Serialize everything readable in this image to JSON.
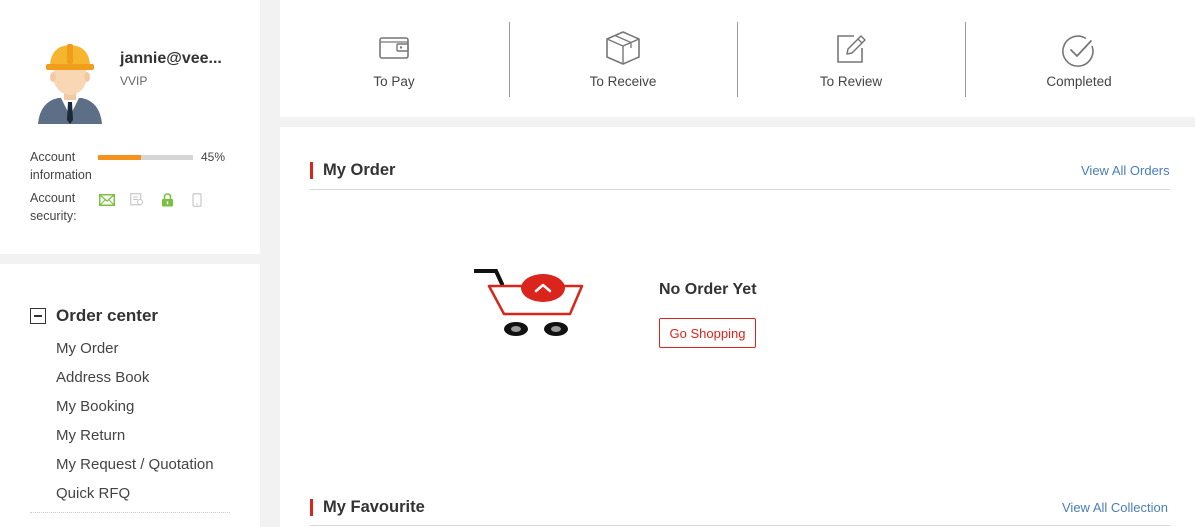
{
  "profile": {
    "username": "jannie@vee...",
    "level": "VVIP",
    "account_info_label": "Account information",
    "progress_percent": 45,
    "progress_text": "45%",
    "account_security_label": "Account security:",
    "security_icons": [
      "email-icon",
      "id-card-icon",
      "lock-icon",
      "phone-icon"
    ]
  },
  "menu": {
    "title": "Order center",
    "items": [
      {
        "label": "My Order"
      },
      {
        "label": "Address Book"
      },
      {
        "label": "My Booking"
      },
      {
        "label": "My Return"
      },
      {
        "label": "My Request / Quotation"
      },
      {
        "label": "Quick RFQ"
      }
    ]
  },
  "order_status": [
    {
      "label": "To Pay",
      "icon": "wallet-icon"
    },
    {
      "label": "To Receive",
      "icon": "box-icon"
    },
    {
      "label": "To Review",
      "icon": "edit-icon"
    },
    {
      "label": "Completed",
      "icon": "check-circle-icon"
    }
  ],
  "my_order": {
    "title": "My Order",
    "view_all": "View All Orders",
    "empty_text": "No Order Yet",
    "shop_button": "Go Shopping"
  },
  "my_favourite": {
    "title": "My Favourite",
    "view_all": "View All Collection"
  },
  "colors": {
    "accent_red": "#d9251c",
    "progress_orange": "#f5921e",
    "link_blue": "#4a7ebb",
    "security_green": "#7ac143"
  }
}
